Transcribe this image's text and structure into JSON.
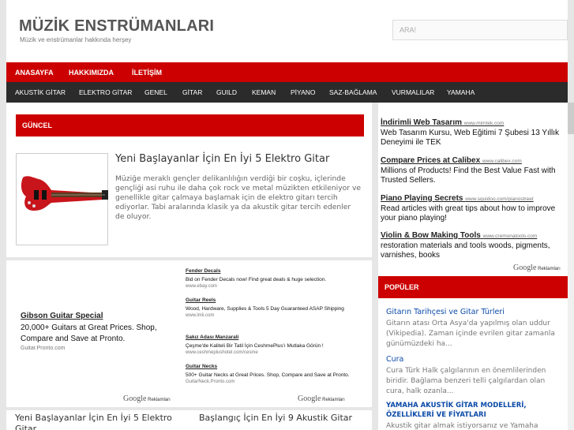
{
  "header": {
    "site_title": "MÜZİK ENSTRÜMANLARI",
    "site_desc": "Müzik ve enstrümanlar hakkında herşey",
    "search_placeholder": "ARA!"
  },
  "topnav": [
    "ANASAYFA",
    "HAKKIMIZDA",
    "İLETİŞİM"
  ],
  "catnav": [
    "AKUSTİK GİTAR",
    "ELEKTRO GİTAR",
    "GENEL",
    "GİTAR",
    "GUILD",
    "KEMAN",
    "PİYANO",
    "SAZ-BAĞLAMA",
    "VURMALILAR",
    "YAMAHA"
  ],
  "main": {
    "section_title": "GÜNCEL",
    "featured": {
      "title": "Yeni Başlayanlar İçin En İyi 5 Elektro Gitar",
      "excerpt": "Müziğe meraklı gençler delikanlılığın verdiği bir coşku, içlerinde gençliği asi ruhu ile daha çok rock ve metal müzikten etkileniyor ve genellikle gitar çalmaya başlamak için de elektro gitarı tercih ediyorlar. Tabi aralarında klasik ya da akustik gitar tercih edenler de oluyor."
    },
    "ad_left": {
      "title": "Gibson Guitar Special",
      "desc": "20,000+ Guitars at Great Prices. Shop, Compare and Save at Pronto.",
      "url": "Guitar.Pronto.com"
    },
    "ad_right": [
      {
        "title": "Fender Decals",
        "desc": "Bid on Fender Decals now! Find great deals & huge selection.",
        "url": "www.ebay.com"
      },
      {
        "title": "Guitar Reels",
        "desc": "Wood, Hardware, Supplies & Tools 5 Day Guaranteed ASAP Shipping",
        "url": "www.lmii.com"
      },
      {
        "title": "Sakız Adası Manzarali",
        "desc": "Çeşme'de Kaliteli Bir Tatil İçin CeshmePlus'ı Mutlaka Görün !",
        "url": "www.ceshmeplushotel.com/cesme"
      },
      {
        "title": "Guitar Necks",
        "desc": "500+ Guitar Necks at Great Prices. Shop, Compare and Save at Pronto.",
        "url": "GuitarNeck.Pronto.com"
      }
    ],
    "google_ads_label": "Reklamları",
    "google_word": "Google",
    "posts": [
      "Yeni Başlayanlar İçin En İyi 5 Elektro Gitar",
      "Başlangıç İçin En İyi 9 Akustik Gitar"
    ]
  },
  "sidebar": {
    "ads": [
      {
        "title": "İndirimli Web Tasarım",
        "url": "www.mimtek.com",
        "desc": "Web Tasarım Kursu, Web Eğitimi 7 Şubesi 13 Yıllık Deneyimi ile TEK"
      },
      {
        "title": "Compare Prices at Calibex",
        "url": "www.calibex.com",
        "desc": "Millions of Products! Find the Best Value Fast with Trusted Sellers."
      },
      {
        "title": "Piano Playing Secrets",
        "url": "www.squidoo.com/pianostreet",
        "desc": "Read articles with great tips about how to improve your piano playing!"
      },
      {
        "title": "Violin & Bow Making Tools",
        "url": "www.cremonatools.com",
        "desc": "restoration materials and tools woods, pigments, varnishes, books"
      }
    ],
    "google_ads_label": "Reklamları",
    "google_word": "Google",
    "populer_title": "POPÜLER",
    "populer": [
      {
        "title": "Gitarın Tarihçesi ve Gitar Türleri",
        "desc": "Gitarın atası Orta Asya'da yapılmış olan uddur (Vikipedia). Zaman içinde evrilen gitar zamanla günümüzdeki ha..."
      },
      {
        "title": "Cura",
        "desc": "Cura Türk Halk çalgılarının en önemlilerinden biridir. Bağlama benzeri telli çalgılardan olan cura, halk ozanla..."
      },
      {
        "title": "YAMAHA AKUSTİK GİTAR MODELLERİ, ÖZELLİKLERİ VE FİYATLARI",
        "desc": "Akustik gitar almak istiyorsanız ve Yamaha"
      }
    ]
  },
  "colors": {
    "accent": "#cc0000",
    "catnav_bg": "#2b2b2b",
    "link": "#0b4aa8"
  }
}
